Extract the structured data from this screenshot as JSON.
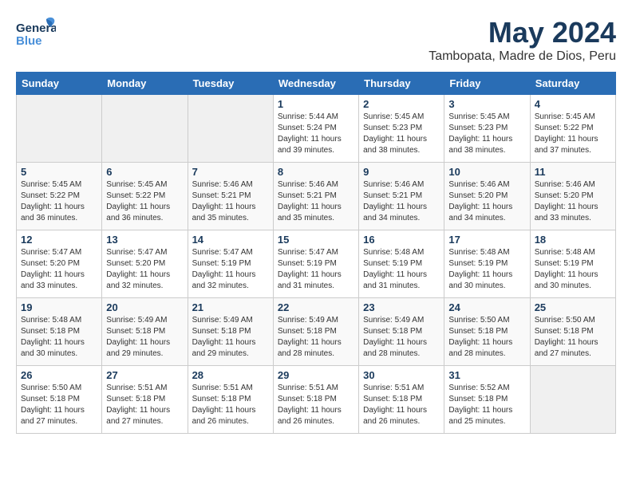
{
  "header": {
    "logo_general": "General",
    "logo_blue": "Blue",
    "main_title": "May 2024",
    "subtitle": "Tambopata, Madre de Dios, Peru"
  },
  "calendar": {
    "days_of_week": [
      "Sunday",
      "Monday",
      "Tuesday",
      "Wednesday",
      "Thursday",
      "Friday",
      "Saturday"
    ],
    "weeks": [
      [
        {
          "day": "",
          "empty": true
        },
        {
          "day": "",
          "empty": true
        },
        {
          "day": "",
          "empty": true
        },
        {
          "day": "1",
          "info": "Sunrise: 5:44 AM\nSunset: 5:24 PM\nDaylight: 11 hours\nand 39 minutes."
        },
        {
          "day": "2",
          "info": "Sunrise: 5:45 AM\nSunset: 5:23 PM\nDaylight: 11 hours\nand 38 minutes."
        },
        {
          "day": "3",
          "info": "Sunrise: 5:45 AM\nSunset: 5:23 PM\nDaylight: 11 hours\nand 38 minutes."
        },
        {
          "day": "4",
          "info": "Sunrise: 5:45 AM\nSunset: 5:22 PM\nDaylight: 11 hours\nand 37 minutes."
        }
      ],
      [
        {
          "day": "5",
          "info": "Sunrise: 5:45 AM\nSunset: 5:22 PM\nDaylight: 11 hours\nand 36 minutes."
        },
        {
          "day": "6",
          "info": "Sunrise: 5:45 AM\nSunset: 5:22 PM\nDaylight: 11 hours\nand 36 minutes."
        },
        {
          "day": "7",
          "info": "Sunrise: 5:46 AM\nSunset: 5:21 PM\nDaylight: 11 hours\nand 35 minutes."
        },
        {
          "day": "8",
          "info": "Sunrise: 5:46 AM\nSunset: 5:21 PM\nDaylight: 11 hours\nand 35 minutes."
        },
        {
          "day": "9",
          "info": "Sunrise: 5:46 AM\nSunset: 5:21 PM\nDaylight: 11 hours\nand 34 minutes."
        },
        {
          "day": "10",
          "info": "Sunrise: 5:46 AM\nSunset: 5:20 PM\nDaylight: 11 hours\nand 34 minutes."
        },
        {
          "day": "11",
          "info": "Sunrise: 5:46 AM\nSunset: 5:20 PM\nDaylight: 11 hours\nand 33 minutes."
        }
      ],
      [
        {
          "day": "12",
          "info": "Sunrise: 5:47 AM\nSunset: 5:20 PM\nDaylight: 11 hours\nand 33 minutes."
        },
        {
          "day": "13",
          "info": "Sunrise: 5:47 AM\nSunset: 5:20 PM\nDaylight: 11 hours\nand 32 minutes."
        },
        {
          "day": "14",
          "info": "Sunrise: 5:47 AM\nSunset: 5:19 PM\nDaylight: 11 hours\nand 32 minutes."
        },
        {
          "day": "15",
          "info": "Sunrise: 5:47 AM\nSunset: 5:19 PM\nDaylight: 11 hours\nand 31 minutes."
        },
        {
          "day": "16",
          "info": "Sunrise: 5:48 AM\nSunset: 5:19 PM\nDaylight: 11 hours\nand 31 minutes."
        },
        {
          "day": "17",
          "info": "Sunrise: 5:48 AM\nSunset: 5:19 PM\nDaylight: 11 hours\nand 30 minutes."
        },
        {
          "day": "18",
          "info": "Sunrise: 5:48 AM\nSunset: 5:19 PM\nDaylight: 11 hours\nand 30 minutes."
        }
      ],
      [
        {
          "day": "19",
          "info": "Sunrise: 5:48 AM\nSunset: 5:18 PM\nDaylight: 11 hours\nand 30 minutes."
        },
        {
          "day": "20",
          "info": "Sunrise: 5:49 AM\nSunset: 5:18 PM\nDaylight: 11 hours\nand 29 minutes."
        },
        {
          "day": "21",
          "info": "Sunrise: 5:49 AM\nSunset: 5:18 PM\nDaylight: 11 hours\nand 29 minutes."
        },
        {
          "day": "22",
          "info": "Sunrise: 5:49 AM\nSunset: 5:18 PM\nDaylight: 11 hours\nand 28 minutes."
        },
        {
          "day": "23",
          "info": "Sunrise: 5:49 AM\nSunset: 5:18 PM\nDaylight: 11 hours\nand 28 minutes."
        },
        {
          "day": "24",
          "info": "Sunrise: 5:50 AM\nSunset: 5:18 PM\nDaylight: 11 hours\nand 28 minutes."
        },
        {
          "day": "25",
          "info": "Sunrise: 5:50 AM\nSunset: 5:18 PM\nDaylight: 11 hours\nand 27 minutes."
        }
      ],
      [
        {
          "day": "26",
          "info": "Sunrise: 5:50 AM\nSunset: 5:18 PM\nDaylight: 11 hours\nand 27 minutes."
        },
        {
          "day": "27",
          "info": "Sunrise: 5:51 AM\nSunset: 5:18 PM\nDaylight: 11 hours\nand 27 minutes."
        },
        {
          "day": "28",
          "info": "Sunrise: 5:51 AM\nSunset: 5:18 PM\nDaylight: 11 hours\nand 26 minutes."
        },
        {
          "day": "29",
          "info": "Sunrise: 5:51 AM\nSunset: 5:18 PM\nDaylight: 11 hours\nand 26 minutes."
        },
        {
          "day": "30",
          "info": "Sunrise: 5:51 AM\nSunset: 5:18 PM\nDaylight: 11 hours\nand 26 minutes."
        },
        {
          "day": "31",
          "info": "Sunrise: 5:52 AM\nSunset: 5:18 PM\nDaylight: 11 hours\nand 25 minutes."
        },
        {
          "day": "",
          "empty": true
        }
      ]
    ]
  }
}
